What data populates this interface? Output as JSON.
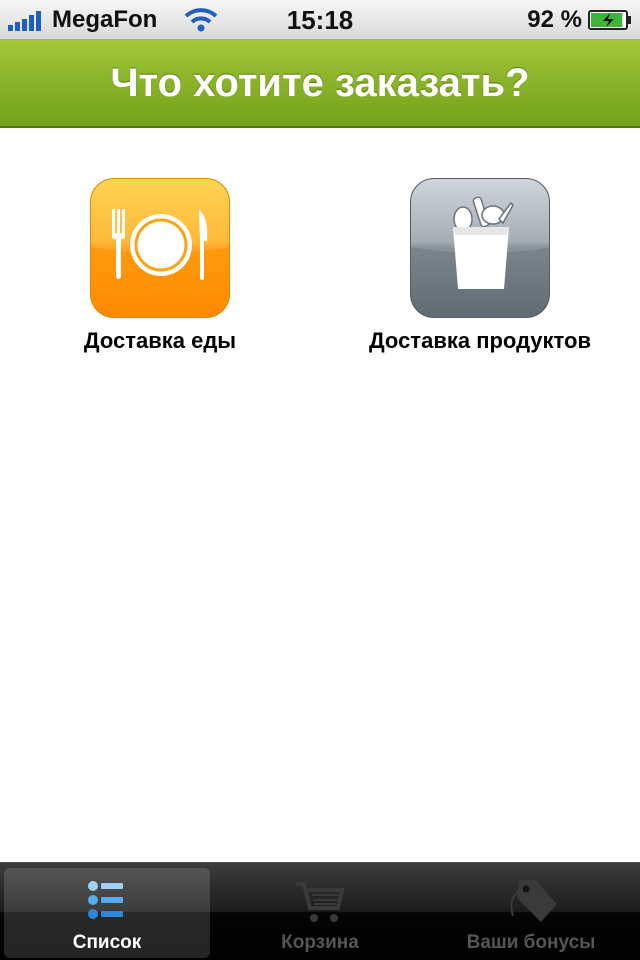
{
  "status_bar": {
    "carrier": "MegaFon",
    "time": "15:18",
    "battery_percent": "92 %",
    "battery_level": 0.92,
    "signal_bars": 5
  },
  "header": {
    "title": "Что хотите заказать?",
    "color": "#8bb42a"
  },
  "categories": [
    {
      "label": "Доставка еды",
      "icon": "plate-cutlery-icon",
      "color": "#ff9a0c"
    },
    {
      "label": "Доставка продуктов",
      "icon": "grocery-bag-icon",
      "color": "#7b858e"
    }
  ],
  "tab_bar": {
    "tabs": [
      {
        "label": "Список",
        "icon": "list-icon",
        "selected": true
      },
      {
        "label": "Корзина",
        "icon": "cart-icon",
        "selected": false
      },
      {
        "label": "Ваши бонусы",
        "icon": "tag-icon",
        "selected": false
      }
    ],
    "active_color": "#3f9fe6"
  }
}
